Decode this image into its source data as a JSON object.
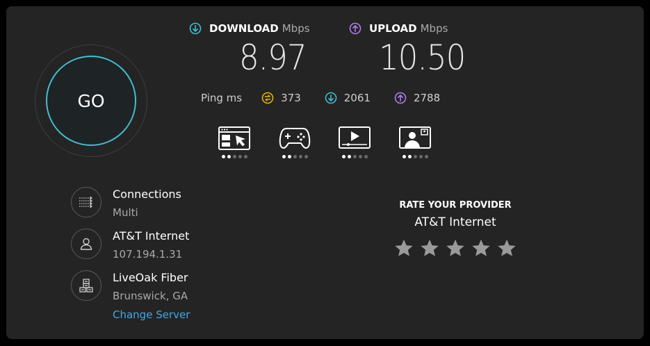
{
  "go": {
    "label": "GO"
  },
  "download": {
    "label": "DOWNLOAD",
    "unit": "Mbps",
    "value": "8.97",
    "icon": "download-arrow-icon",
    "color": "#3fbfd0"
  },
  "upload": {
    "label": "UPLOAD",
    "unit": "Mbps",
    "value": "10.50",
    "icon": "upload-arrow-icon",
    "color": "#b07cf0"
  },
  "ping": {
    "label": "Ping ms",
    "idle": {
      "value": "373",
      "icon": "ping-idle-icon",
      "color": "#e6b400"
    },
    "download": {
      "value": "2061",
      "icon": "download-arrow-icon",
      "color": "#3fbfd0"
    },
    "upload": {
      "value": "2788",
      "icon": "upload-arrow-icon",
      "color": "#b07cf0"
    }
  },
  "activities": [
    {
      "icon": "web-browsing-icon",
      "rating": 2,
      "of": 5
    },
    {
      "icon": "gaming-controller-icon",
      "rating": 2,
      "of": 5
    },
    {
      "icon": "video-streaming-icon",
      "rating": 2,
      "of": 5
    },
    {
      "icon": "video-call-icon",
      "rating": 2,
      "of": 5
    }
  ],
  "connections": {
    "title": "Connections",
    "value": "Multi",
    "icon": "connections-icon"
  },
  "isp": {
    "name": "AT&T Internet",
    "ip": "107.194.1.31",
    "icon": "user-icon"
  },
  "server": {
    "name": "LiveOak Fiber",
    "location": "Brunswick, GA",
    "change_label": "Change Server",
    "icon": "server-icon"
  },
  "rating": {
    "title": "RATE YOUR PROVIDER",
    "provider": "AT&T Internet",
    "stars": 5,
    "star_icon": "star-icon"
  }
}
